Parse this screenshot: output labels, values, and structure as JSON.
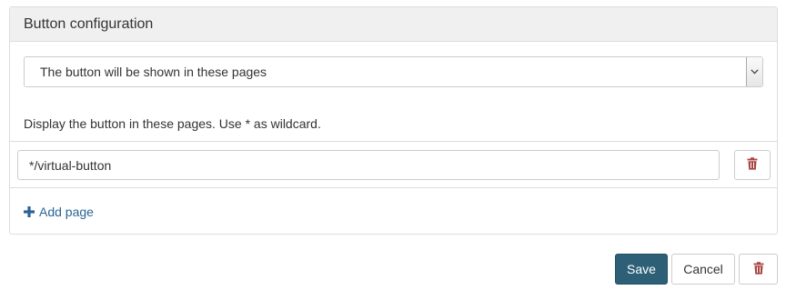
{
  "panel": {
    "title": "Button configuration",
    "visibility_select": {
      "selected": "The button will be shown in these pages"
    },
    "help_text": "Display the button in these pages. Use * as wildcard.",
    "pages": [
      {
        "value": "*/virtual-button",
        "delete_icon": "trash-icon"
      }
    ],
    "add_page_label": "Add page",
    "add_page_icon": "plus-icon"
  },
  "actions": {
    "save_label": "Save",
    "cancel_label": "Cancel",
    "delete_icon": "trash-icon"
  },
  "colors": {
    "accent": "#2d6077",
    "link": "#2a6496",
    "danger": "#a94442"
  }
}
